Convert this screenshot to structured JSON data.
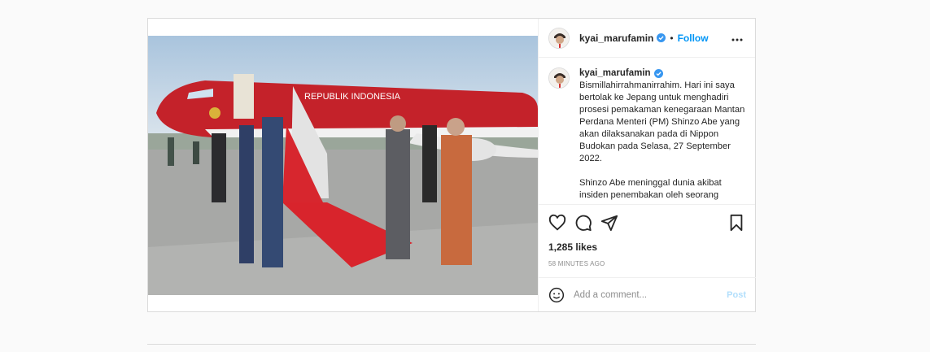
{
  "header": {
    "username": "kyai_marufamin",
    "separator": "•",
    "follow_label": "Follow"
  },
  "photo": {
    "plane_text": "REPUBLIK INDONESIA"
  },
  "caption": {
    "username": "kyai_marufamin",
    "text": "Bismillahirrahmanirrahim. Hari ini saya bertolak ke Jepang untuk menghadiri prosesi pemakaman kenegaraan Mantan Perdana Menteri (PM) Shinzo Abe yang akan dilaksanakan pada di Nippon Budokan pada Selasa, 27 September 2022.\n\nShinzo Abe meninggal dunia akibat insiden penembakan oleh seorang"
  },
  "stats": {
    "likes": "1,285 likes",
    "time": "58 MINUTES AGO"
  },
  "comment": {
    "placeholder": "Add a comment...",
    "post_label": "Post"
  },
  "colors": {
    "accent": "#0095f6",
    "post_disabled": "#b2dffc",
    "verified": "#3897f0"
  },
  "icons": [
    "more-options-icon",
    "verified-badge-icon",
    "heart-icon",
    "comment-icon",
    "share-icon",
    "bookmark-icon",
    "emoji-icon"
  ]
}
